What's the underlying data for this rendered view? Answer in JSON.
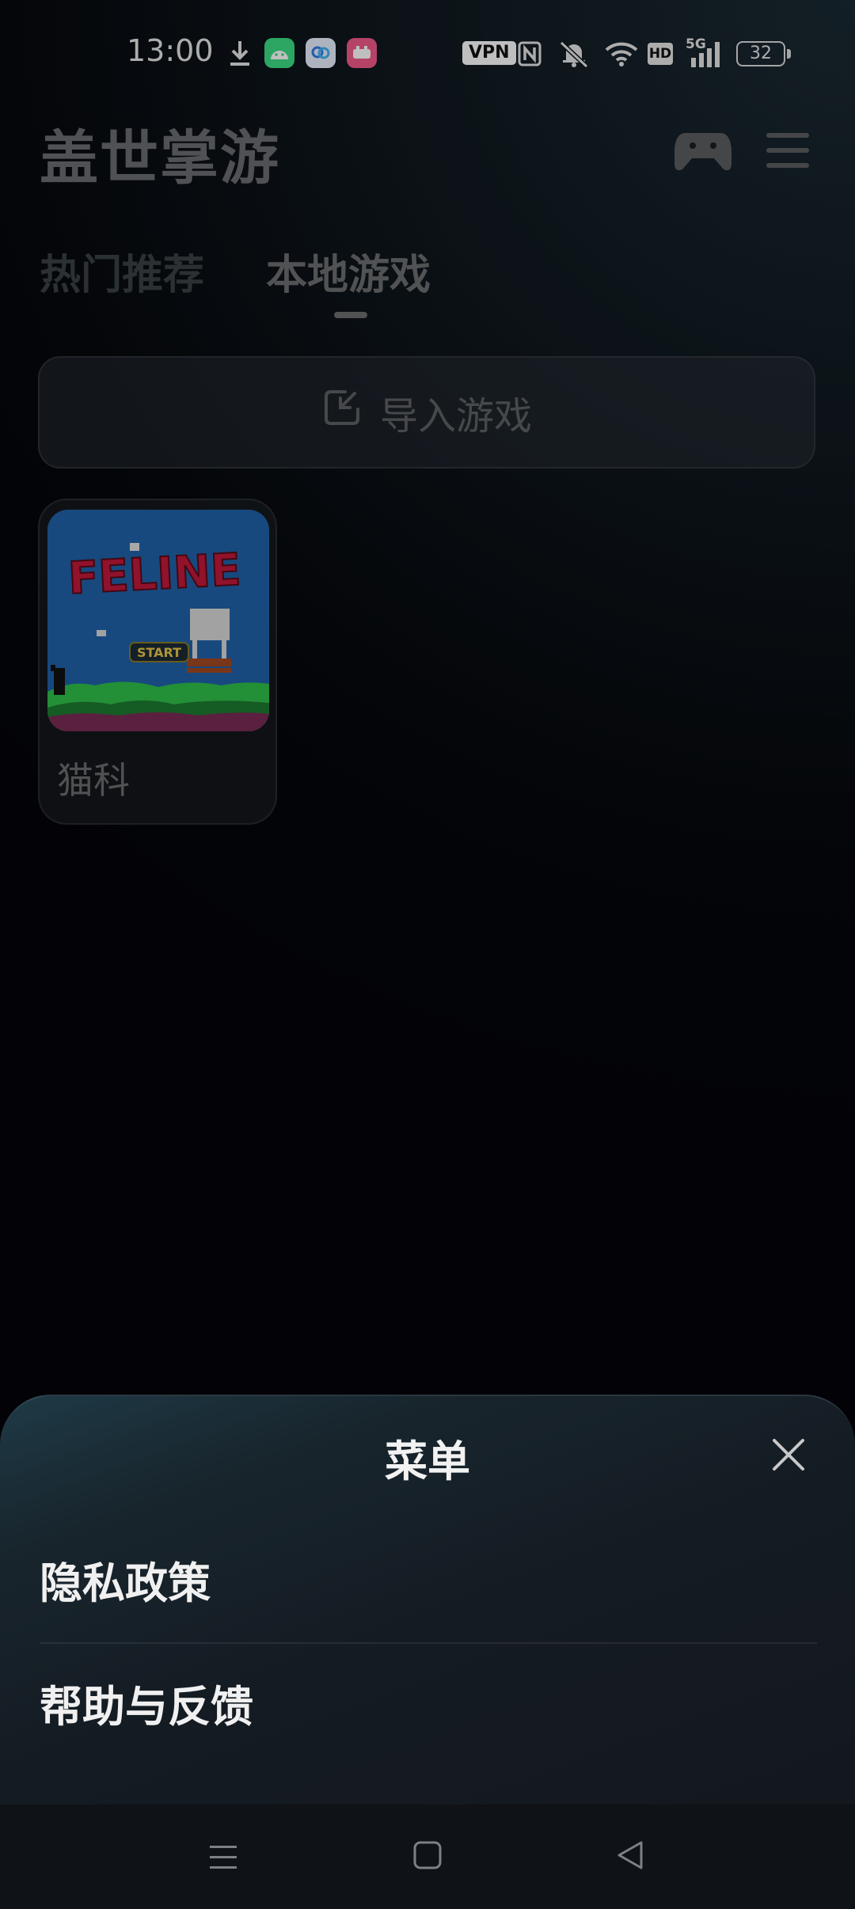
{
  "status_bar": {
    "time": "13:00",
    "vpn_label": "VPN",
    "hd_label": "HD",
    "network_label": "5G",
    "battery_level": "32",
    "icons": [
      "download-icon",
      "android-app-icon",
      "cloud-app-icon",
      "pink-app-icon",
      "nfc-icon",
      "mute-bell-icon",
      "wifi-icon",
      "signal-icon",
      "battery-icon"
    ]
  },
  "header": {
    "app_title": "盖世掌游",
    "icons": [
      "gamepad-icon",
      "hamburger-menu-icon"
    ]
  },
  "tabs": [
    {
      "label": "热门推荐",
      "active": false
    },
    {
      "label": "本地游戏",
      "active": true
    }
  ],
  "import_button": {
    "label": "导入游戏",
    "icon": "import-icon"
  },
  "games": [
    {
      "name": "猫科",
      "thumbnail_title": "FELINE",
      "thumbnail_button": "START"
    }
  ],
  "menu_sheet": {
    "title": "菜单",
    "close_icon": "close-icon",
    "items": [
      {
        "label": "隐私政策"
      },
      {
        "label": "帮助与反馈"
      }
    ]
  },
  "nav_bar": {
    "icons": [
      "recent-apps-icon",
      "home-icon",
      "back-icon"
    ]
  },
  "colors": {
    "background": "#05070b",
    "sheet": "#141b22",
    "accent_text": "#f0f0f0"
  }
}
